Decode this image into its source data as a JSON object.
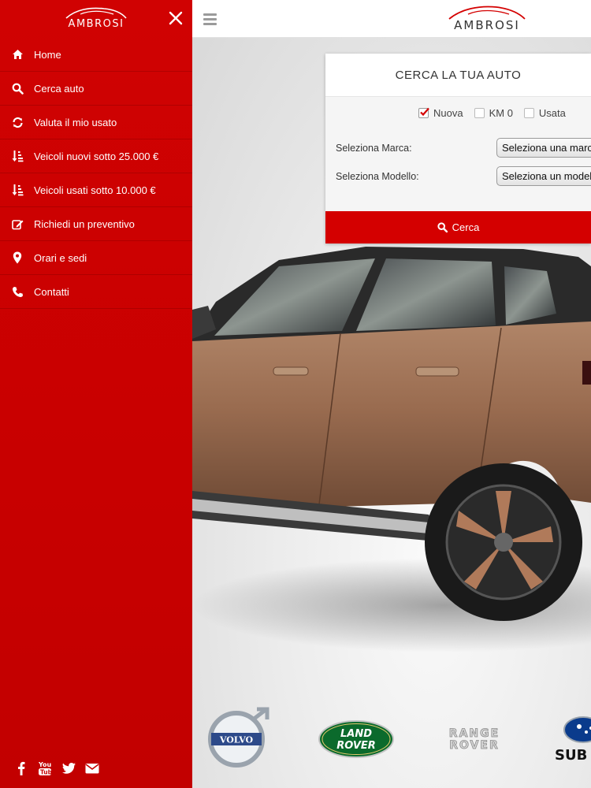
{
  "sidebar": {
    "logo_text": "AMBROSI",
    "items": [
      {
        "label": "Home",
        "icon": "home-icon"
      },
      {
        "label": "Cerca auto",
        "icon": "search-icon"
      },
      {
        "label": "Valuta il mio usato",
        "icon": "refresh-icon"
      },
      {
        "label": "Veicoli nuovi sotto 25.000 €",
        "icon": "sort-amount-icon"
      },
      {
        "label": "Veicoli usati sotto 10.000 €",
        "icon": "sort-amount-icon"
      },
      {
        "label": "Richiedi un preventivo",
        "icon": "edit-icon"
      },
      {
        "label": "Orari e sedi",
        "icon": "map-marker-icon"
      },
      {
        "label": "Contatti",
        "icon": "phone-icon"
      }
    ],
    "social": [
      "facebook-icon",
      "youtube-icon",
      "twitter-icon",
      "envelope-icon"
    ]
  },
  "header": {
    "logo_text": "AMBROSI"
  },
  "search": {
    "title": "CERCA LA TUA AUTO",
    "types": [
      {
        "label": "Nuova",
        "checked": true
      },
      {
        "label": "KM 0",
        "checked": false
      },
      {
        "label": "Usata",
        "checked": false
      }
    ],
    "brand_label": "Seleziona Marca:",
    "brand_value": "Seleziona una marca",
    "model_label": "Seleziona Modello:",
    "model_value": "Seleziona un modello",
    "button_label": "Cerca"
  },
  "brands": {
    "volvo": "VOLVO",
    "landrover_1": "LAND",
    "landrover_2": "ROVER",
    "rangerover_1": "RANGE",
    "rangerover_2": "ROVER",
    "subaru": "SUB"
  },
  "colors": {
    "accent": "#d40000",
    "sidebar": "#cc0000"
  }
}
